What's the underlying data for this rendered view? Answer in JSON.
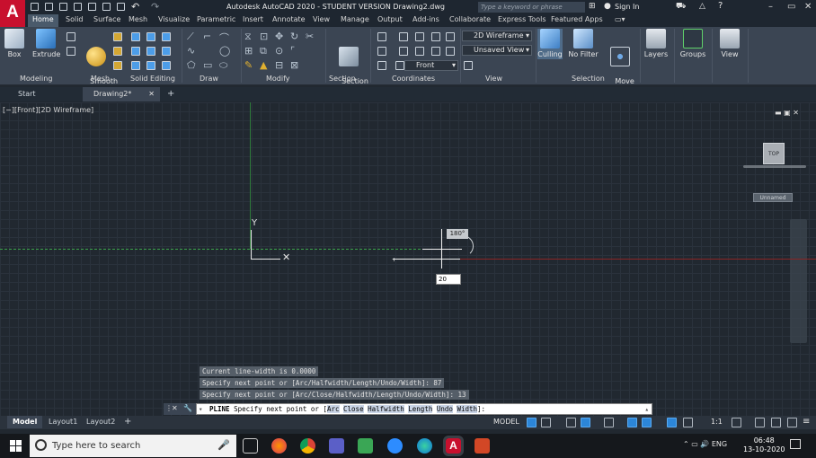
{
  "titlebar": {
    "app_logo": "A",
    "title": "Autodesk AutoCAD 2020 - STUDENT VERSION   Drawing2.dwg",
    "search_placeholder": "Type a keyword or phrase",
    "signin": "Sign In",
    "help": "?"
  },
  "tabs": [
    "Home",
    "Solid",
    "Surface",
    "Mesh",
    "Visualize",
    "Parametric",
    "Insert",
    "Annotate",
    "View",
    "Manage",
    "Output",
    "Add-ins",
    "Collaborate",
    "Express Tools",
    "Featured Apps"
  ],
  "ribbon": {
    "box": "Box",
    "extrude": "Extrude",
    "smooth_object": "Smooth\nObject",
    "section_plane": "Section\nPlane",
    "culling": "Culling",
    "no_filter": "No Filter",
    "move_gizmo": "Move\nGizmo",
    "layers": "Layers",
    "groups": "Groups",
    "view": "View",
    "visual_style": "2D Wireframe",
    "saved_view": "Unsaved View",
    "view_direction": "Front",
    "panels": [
      "Modeling",
      "Mesh",
      "Solid Editing",
      "Draw",
      "Modify",
      "Section",
      "Coordinates",
      "View",
      "Selection"
    ]
  },
  "file_tabs": {
    "start": "Start",
    "drawing": "Drawing2*",
    "add": "+"
  },
  "viewport": {
    "label": "[−][Front][2D Wireframe]",
    "controls": "▬  ▣  ✕",
    "viewcube": "TOP",
    "ucs_badge": "Unnamed",
    "ucs_y": "Y",
    "ucs_x": "✕",
    "angle_tooltip": "180°",
    "dynamic_input": "20"
  },
  "command": {
    "history": [
      "Current line-width is 0.0000",
      "Specify next point or [Arc/Halfwidth/Length/Undo/Width]: 87",
      "Specify next point or [Arc/Close/Halfwidth/Length/Undo/Width]: 13"
    ],
    "prompt_cmd": "PLINE",
    "prompt_text": "Specify next point or [",
    "options": [
      "Arc",
      "Close",
      "Halfwidth",
      "Length",
      "Undo",
      "Width"
    ],
    "prompt_end": "]:"
  },
  "layout_tabs": [
    "Model",
    "Layout1",
    "Layout2",
    "+"
  ],
  "status_bar": {
    "model": "MODEL",
    "scale": "1:1"
  },
  "taskbar": {
    "search_placeholder": "Type here to search",
    "language": "ENG",
    "time": "06:48",
    "date": "13-10-2020"
  }
}
